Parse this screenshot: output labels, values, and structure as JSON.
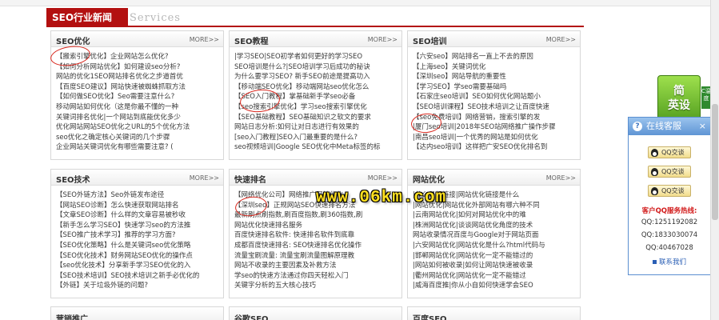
{
  "section": {
    "title": "SEO行业新闻",
    "subtitle": "Services"
  },
  "more_label": "MORE>>",
  "panels": [
    {
      "title": "SEO优化",
      "items": [
        "【搬索引擎优化】企业网站怎么优化?",
        "【如何分析网站优化】如何建设seo分析?",
        "网站的优化1SEO网站排名优化之步道首优",
        "【百度SEO建议】网站快速被蜘蛛抓取方法",
        "【如何做SEO优化】Seo需要注意什么?",
        "移动网站如何优化（这是你最不懂的一种",
        "关键词排名优化|一个网站到底能优化多少",
        "优化网站网站SEO优化之URL的5个优化方法",
        "seo优化之确定核心关键词的几个步骤",
        "企业网站关键词优化有哪些需要注意? ("
      ]
    },
    {
      "title": "SEO教程",
      "items": [
        "|学习SEO|SEO初学者如何更好的学习SEO",
        "SEO培训是什么?|SEO培训学习后成功的秘诀",
        "为什么要学习SEO? 新手SEO前途是提高功入",
        "【移动端SEO优化】移动端网站seo优化怎么",
        "【SEO入门教程】掌基础新手学seo必备",
        "【seo搜索引擎优化】学习seo搜索引擎优化",
        "【SEO基础教程】SEO基础知识之软文的要求",
        "网站日志分析:如何让对日志进行有效果的",
        "[seo入门教程]SEO入门最重要的是什么?",
        "seo视频培训|Google SEO优化中Meta标签的标"
      ]
    },
    {
      "title": "SEO培训",
      "items": [
        "【六安seo】网站排名一直上不去的原因",
        "【上海seo】关键词优化",
        "【深圳seo】网站导航的重要性",
        "【学习SEO】学seo需要基础吗",
        "【石家庄seo培训】SEO如何优化网站题小",
        "【SEO培训课程】SEO技术培训之让百度快速",
        "【seo免费培训】网络营销，搜索引擎的发",
        "|厦门seo培训|2018年SEO站网络推广操作步骤",
        "|南昌seo培训|一个优秀的网站是如何优化",
        "【达内seo培训】这样把广安SEO优化排名到"
      ]
    },
    {
      "title": "SEO技术",
      "items": [
        "【SEO外链方法】Seo外链发布途径",
        "【网站SEO诊断】怎么快速获取网站排名",
        "【文章SEO诊断】什么样的文章容易被秒收",
        "【新手怎么学习SEO】快速学习seo的方法推",
        "【SEO推广技术学习】推荐的学习方面?",
        "【SEO优化策略】什么是关键词seo优化策略",
        "【SEO优化技术】财务网站SEO优化的操作点",
        "【seo优化技术】分享新手学习SEO优化的入",
        "【SEO技术培训】SEO技术培训之新手必优化的",
        "【外链】关于垃圾外链的问题?"
      ]
    },
    {
      "title": "快速排名",
      "items": [
        "【网络优化公司】网络推广网站优化",
        "【深圳seo】正规网站SEO快速排名方法",
        "最新刷点刷指数,刷百度指数,刷360指数,刷",
        "网站优化快速排名服务",
        "百度快速排名软件: 快速排名软件到底靠",
        "成都百度快速排名: SEO快速排名优化操作",
        "流量宝刷流量: 流量宝刷流量图解原理教",
        "网站不收录的主要因素及补救方法",
        "学seo的快速方法通过你四天轻松入门",
        "关键字分析的五大核心技巧"
      ]
    },
    {
      "title": "网站优化",
      "items": [
        "|什么是超链接|网站优化链接是什么",
        "|网站优化|网站优化外部网站有哪六种不同",
        "|云南网站优化|如何对网站优化中的难",
        "|株洲网站优化|谈谈网站优化角度的技术",
        "网站收录情况百度与Google对于网站页面",
        "|六安网站优化|网站优化是什么?html代码与",
        "|邯郸网站优化|网站优化一定不能错过的",
        "|网站如何被收录|如何让网站快速被收录",
        "|衢州网站优化|网站优化一定不能错过",
        "|威海百度推|你从小自如何快速学会SEO"
      ]
    }
  ],
  "bottom_panels": [
    "营销推广",
    "谷歌SEO",
    "百度SEO"
  ],
  "watermark": "www.06km.com",
  "side_widget": {
    "badge_line1": "简",
    "badge_line2": "英设",
    "side_tab_text": "C温度",
    "service_title": "在线客服",
    "service_icon": "?",
    "close_label": "×",
    "qq_buttons": [
      "QQ交谈",
      "QQ交谈",
      "QQ交谈"
    ],
    "hotline_title": "客户QQ服务热线:",
    "qq_numbers": [
      "QQ:1251192082",
      "QQ:1833030074",
      "QQ:40467028"
    ],
    "contact_label": "联系我们"
  },
  "colors": {
    "brand_red": "#b31010",
    "annotation_red": "#d9261c",
    "service_blue": "#5f95d4",
    "badge_green": "#4f9b1d"
  }
}
